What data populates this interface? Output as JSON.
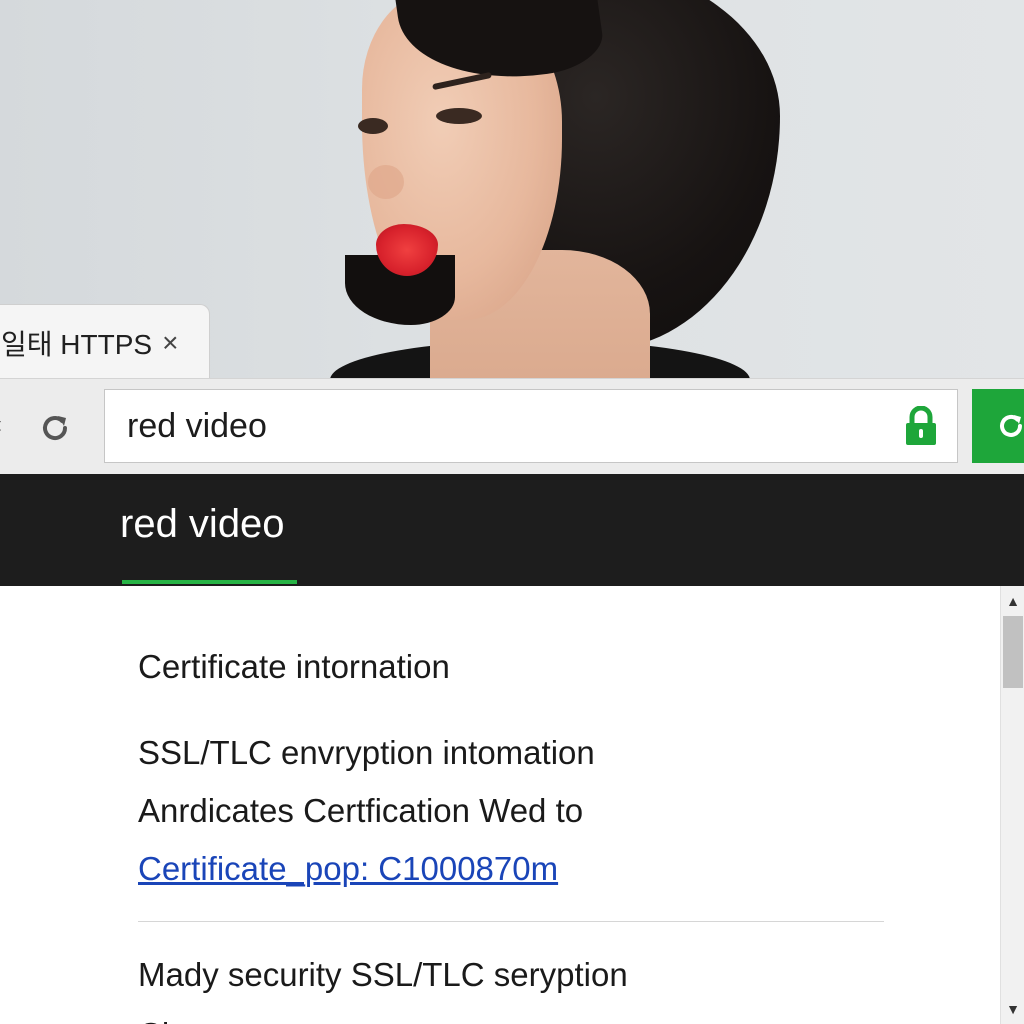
{
  "tab": {
    "title": "일태 HTTPS",
    "close_glyph": "×"
  },
  "toolbar": {
    "address_value": "red video",
    "lock_icon": "lock-icon",
    "reload_icon": "reload-icon",
    "accent_color": "#1ea63a"
  },
  "header": {
    "title": "red video",
    "underline_color": "#27b445"
  },
  "content": {
    "section_title": "Certificate intornation",
    "line1": "SSL/TLC envryption intomation",
    "line2": "Anrdicates Certfication Wed to",
    "link": "Certificate_pop: C1000870m",
    "line3": "Mady security SSL/TLC seryption",
    "line4": "Cl"
  }
}
